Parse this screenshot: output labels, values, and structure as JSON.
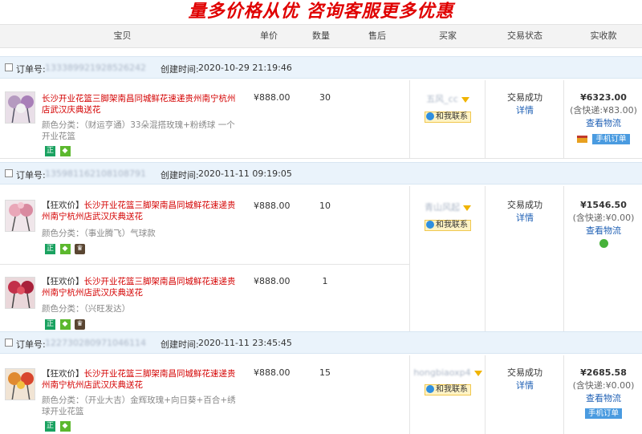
{
  "banner": "量多价格从优  咨询客服更多优惠",
  "header": {
    "item": "宝贝",
    "price": "单价",
    "qty": "数量",
    "after_sale": "售后",
    "buyer": "买家",
    "status": "交易状态",
    "paid": "实收款"
  },
  "labels": {
    "order_no": "订单号:",
    "created": "创建时间:",
    "contact": "和我联系",
    "detail": "详情",
    "logistics": "查看物流",
    "mobile": "手机订单",
    "tag_zheng": "正"
  },
  "orders": [
    {
      "order_no": "133389921928526242",
      "created_time": "2020-10-29 21:19:46",
      "buyer": "五风_cc",
      "status": "交易成功",
      "amount": "¥6323.00",
      "shipping": "(含快递:¥83.00)",
      "items": [
        {
          "prefix": "",
          "title": "长沙开业花篮三脚架南昌同城鲜花速递贵州南宁杭州店武汉庆典送花",
          "sku": "颜色分类：（财运亨通）33朵混搭玫瑰+粉绣球 一个开业花篮",
          "price": "¥888.00",
          "qty": "30",
          "thumb_color": "#b59ac0"
        }
      ]
    },
    {
      "order_no": "135981162108108791",
      "created_time": "2020-11-11 09:19:05",
      "buyer": "青山风起",
      "status": "交易成功",
      "amount": "¥1546.50",
      "shipping": "(含快递:¥0.00)",
      "items": [
        {
          "prefix": "【狂欢价】",
          "title": "长沙开业花篮三脚架南昌同城鲜花速递贵州南宁杭州店武汉庆典送花",
          "sku": "颜色分类：（事业腾飞）气球款",
          "price": "¥888.00",
          "qty": "10",
          "thumb_color": "#d98aa0"
        },
        {
          "prefix": "【狂欢价】",
          "title": "长沙开业花篮三脚架南昌同城鲜花速递贵州南宁杭州店武汉庆典送花",
          "sku": "颜色分类：（兴旺发达）",
          "price": "¥888.00",
          "qty": "1",
          "thumb_color": "#c2304a"
        }
      ]
    },
    {
      "order_no": "122730280971046114",
      "created_time": "2020-11-11 23:45:45",
      "buyer": "hongbiaoxp4",
      "status": "交易成功",
      "amount": "¥2685.58",
      "shipping": "(含快递:¥0.00)",
      "items": [
        {
          "prefix": "【狂欢价】",
          "title": "长沙开业花篮三脚架南昌同城鲜花速递贵州南宁杭州店武汉庆典送花",
          "sku": "颜色分类：（开业大吉）金辉玫瑰+向日葵+百合+绣球开业花篮",
          "price": "¥888.00",
          "qty": "15",
          "thumb_color": "#e08a30"
        }
      ]
    }
  ]
}
